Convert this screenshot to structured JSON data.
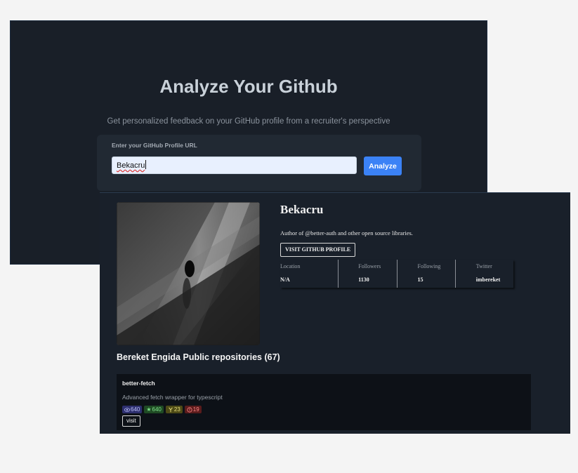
{
  "analyzer": {
    "title": "Analyze Your Github",
    "subtitle": "Get personalized feedback on your GitHub profile from a recruiter's perspective",
    "input_label": "Enter your GitHub Profile URL",
    "input_value": "Bekacru",
    "analyze_label": "Analyze",
    "accent": "#3b82f6"
  },
  "profile": {
    "avatar_icon": "profile-avatar-image",
    "name": "Bekacru",
    "bio": "Author of @better-auth and other open source libraries.",
    "visit_label": "VISIT GITHUB PROFILE",
    "stats": [
      {
        "label": "Location",
        "value": "N/A"
      },
      {
        "label": "Followers",
        "value": "1130"
      },
      {
        "label": "Following",
        "value": "15"
      },
      {
        "label": "Twitter",
        "value": "imbereket"
      }
    ]
  },
  "repos": {
    "heading": "Bereket Engida Public repositories (67)",
    "items": [
      {
        "name": "better-fetch",
        "description": "Advanced fetch wrapper for typescript",
        "watchers": "640",
        "stars": "640",
        "forks": "23",
        "issues": "19",
        "visit_label": "visit"
      }
    ]
  }
}
